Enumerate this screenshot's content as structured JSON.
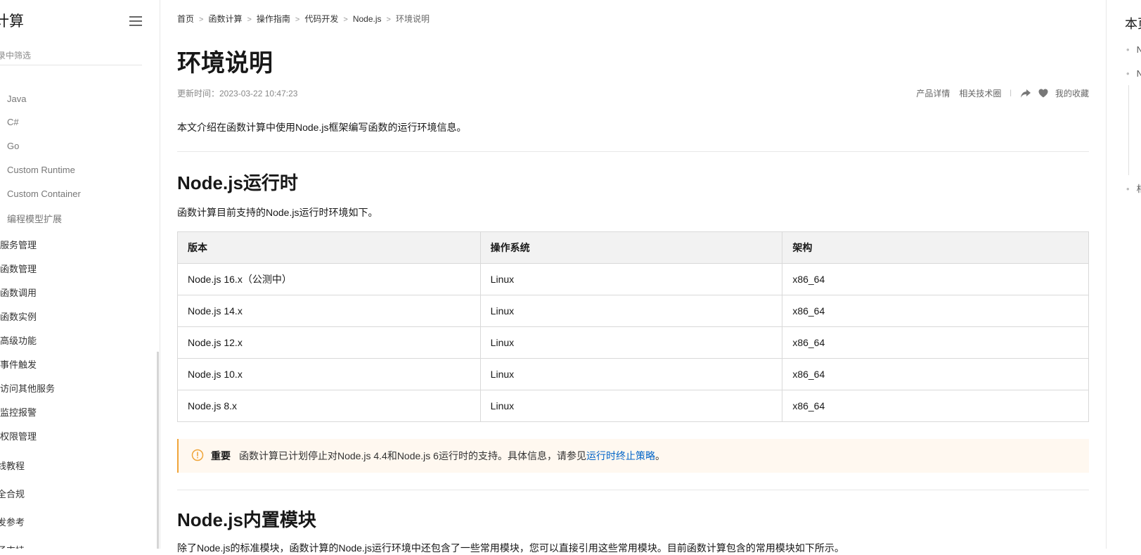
{
  "sidebar": {
    "title": "计算",
    "filter_placeholder": "录中筛选",
    "sub_items": [
      "Java",
      "C#",
      "Go",
      "Custom Runtime",
      "Custom Container",
      "编程模型扩展"
    ],
    "top_items": [
      "服务管理",
      "函数管理",
      "函数调用",
      "函数实例",
      "高级功能",
      "事件触发",
      "访问其他服务",
      "监控报警",
      "权限管理"
    ],
    "root_items": [
      "线教程",
      "全合规",
      "发参考",
      "子支持"
    ]
  },
  "breadcrumb": [
    "首页",
    "函数计算",
    "操作指南",
    "代码开发",
    "Node.js",
    "环境说明"
  ],
  "page": {
    "title": "环境说明",
    "update_time": "更新时间：2023-03-22 10:47:23",
    "actions": {
      "product_detail": "产品详情",
      "tech_circle": "相关技术圈",
      "separator": "|",
      "favorite": "我的收藏"
    },
    "intro": "本文介绍在函数计算中使用Node.js框架编写函数的运行环境信息。"
  },
  "section1": {
    "heading": "Node.js运行时",
    "desc": "函数计算目前支持的Node.js运行时环境如下。"
  },
  "runtime_table": {
    "headers": [
      "版本",
      "操作系统",
      "架构"
    ],
    "rows": [
      [
        "Node.js 16.x（公测中）",
        "Linux",
        "x86_64"
      ],
      [
        "Node.js 14.x",
        "Linux",
        "x86_64"
      ],
      [
        "Node.js 12.x",
        "Linux",
        "x86_64"
      ],
      [
        "Node.js 10.x",
        "Linux",
        "x86_64"
      ],
      [
        "Node.js 8.x",
        "Linux",
        "x86_64"
      ]
    ]
  },
  "notice": {
    "label": "重要",
    "text": "函数计算已计划停止对Node.js 4.4和Node.js 6运行时的支持。具体信息，请参见",
    "link": "运行时终止策略",
    "end": "。"
  },
  "section2": {
    "heading": "Node.js内置模块",
    "desc": "除了Node.js的标准模块，函数计算的Node.js运行环境中还包含了一些常用模块，您可以直接引用这些常用模块。目前函数计算包含的常用模块如下所示。"
  },
  "toc": {
    "title": "本页",
    "items": [
      "N",
      "N",
      "相"
    ]
  },
  "colors": {
    "link": "#0064c8",
    "notice_bg": "#fff8f0",
    "notice_border": "#f0a53a",
    "table_header_bg": "#f2f2f2"
  }
}
